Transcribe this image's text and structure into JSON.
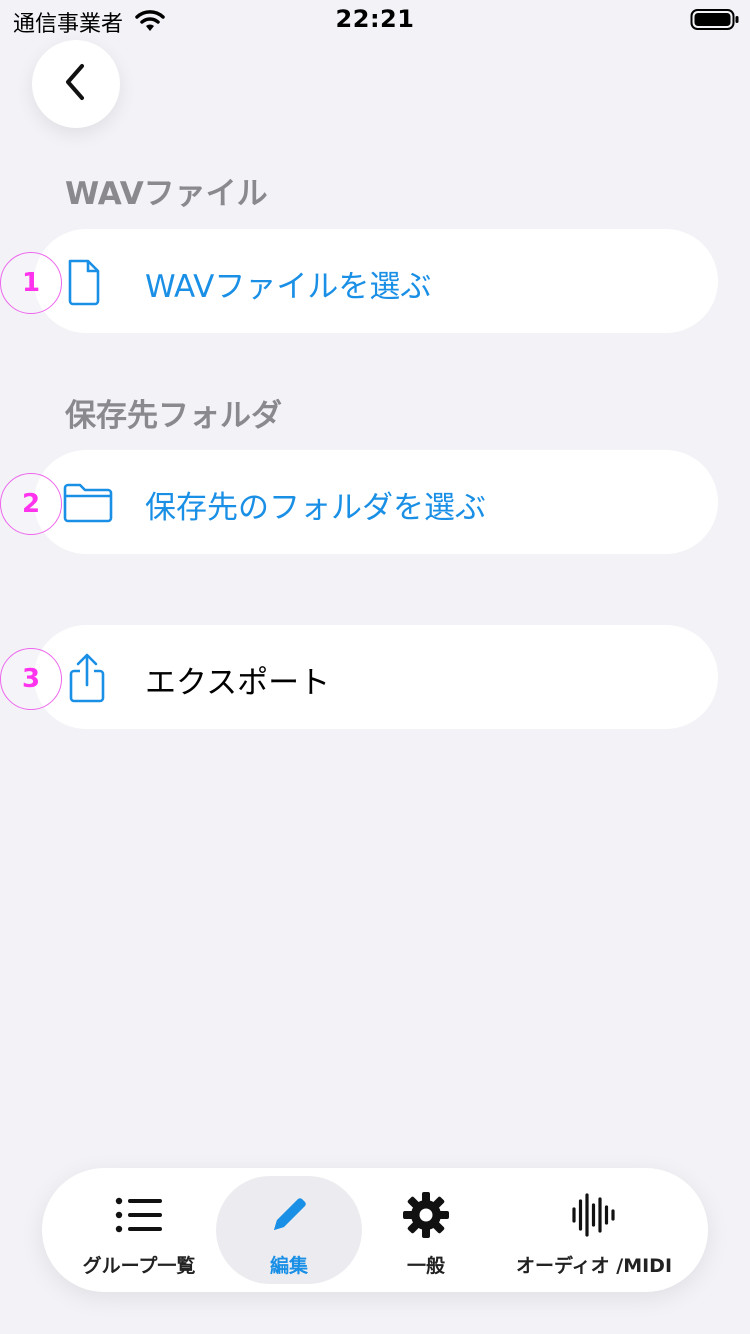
{
  "status_bar": {
    "carrier": "通信事業者",
    "time": "22:21"
  },
  "sections": {
    "wav": {
      "header": "WAVファイル",
      "button_label": "WAVファイルを選ぶ",
      "icon": "document-icon",
      "badge": "1"
    },
    "folder": {
      "header": "保存先フォルダ",
      "button_label": "保存先のフォルダを選ぶ",
      "icon": "folder-icon",
      "badge": "2"
    },
    "export": {
      "button_label": "エクスポート",
      "icon": "share-icon",
      "badge": "3"
    }
  },
  "tab_bar": {
    "items": [
      {
        "label": "グループ一覧",
        "icon": "list-icon",
        "active": false
      },
      {
        "label": "編集",
        "icon": "pencil-icon",
        "active": true
      },
      {
        "label": "一般",
        "icon": "gear-icon",
        "active": false
      },
      {
        "label": "オーディオ /MIDI",
        "icon": "waveform-icon",
        "active": false
      }
    ]
  },
  "colors": {
    "background": "#f2f2f7",
    "accent": "#1a8fe6",
    "section_header": "#8a8a8e",
    "badge": "#ff33ee"
  }
}
